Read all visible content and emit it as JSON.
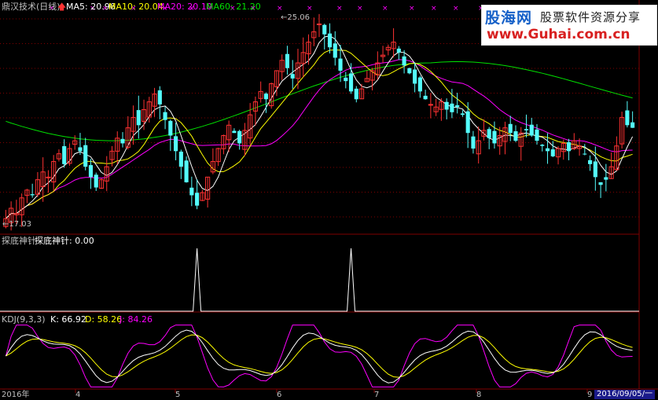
{
  "header": {
    "title": "鼎汉技术(日线)",
    "ma5": "MA5: 20.96",
    "ma10": "MA10: 20.04",
    "ma20": "MA20: 20.10",
    "ma60": "MA60: 21.20",
    "high_mark": "25.06",
    "low_mark": "17.03"
  },
  "indicator1": {
    "name": "探底神针",
    "label": "探底神针",
    "value": "0.00"
  },
  "indicator2": {
    "name": "KDJ(9,3,3)",
    "k": "K: 66.92",
    "d": "D: 58.26",
    "j": "J: 84.26"
  },
  "xaxis": {
    "start": "2016年",
    "months": [
      "4",
      "5",
      "6",
      "7",
      "8",
      "9"
    ],
    "cursor_date": "2016/09/05/一"
  },
  "watermark": {
    "line1a": "股海网",
    "line1b": "股票软件资源分享",
    "line2": "www.Guhai.com.cn"
  },
  "colors": {
    "up": "#ff3232",
    "down": "#54fcfc",
    "ma5": "#ffffff",
    "ma10": "#ffff00",
    "ma20": "#ff00ff",
    "ma60": "#00e000",
    "grid": "#800000"
  },
  "chart_data": [
    {
      "type": "candlestick",
      "title": "鼎汉技术(日线)",
      "series": [
        {
          "name": "MA5",
          "last": 20.96
        },
        {
          "name": "MA10",
          "last": 20.04
        },
        {
          "name": "MA20",
          "last": 20.1
        },
        {
          "name": "MA60",
          "last": 21.2
        }
      ],
      "annotations": {
        "high": 25.06,
        "low": 17.03
      },
      "ylim": [
        16.8,
        25.4
      ],
      "x_tick_labels": [
        "2016年",
        "4",
        "5",
        "6",
        "7",
        "8",
        "9"
      ],
      "close": [
        17.4,
        17.8,
        17.6,
        18.2,
        18.5,
        18.3,
        18.9,
        19.2,
        19.0,
        19.6,
        19.9,
        19.5,
        20.1,
        20.4,
        20.0,
        19.4,
        19.0,
        18.6,
        18.9,
        19.4,
        20.0,
        20.5,
        20.3,
        20.9,
        21.3,
        21.0,
        21.6,
        21.9,
        22.2,
        21.8,
        21.2,
        20.6,
        20.0,
        19.4,
        18.8,
        18.3,
        17.9,
        18.4,
        19.0,
        19.6,
        20.1,
        20.6,
        21.0,
        20.7,
        20.3,
        20.8,
        21.4,
        21.9,
        22.3,
        22.0,
        22.6,
        23.1,
        23.5,
        23.2,
        22.8,
        23.4,
        23.8,
        24.2,
        24.6,
        24.9,
        24.5,
        24.0,
        23.6,
        23.1,
        22.7,
        22.3,
        22.0,
        22.4,
        22.8,
        23.1,
        23.4,
        23.7,
        24.0,
        24.2,
        23.8,
        23.3,
        23.0,
        22.6,
        22.3,
        22.0,
        21.8,
        21.7,
        21.9,
        21.6,
        21.5,
        21.7,
        21.4,
        20.7,
        20.1,
        20.4,
        20.8,
        20.5,
        20.3,
        20.6,
        20.9,
        20.7,
        20.4,
        20.7,
        20.8,
        20.6,
        20.4,
        20.2,
        20.0,
        19.8,
        20.1,
        20.3,
        20.0,
        20.4,
        20.2,
        19.9,
        19.5,
        19.0,
        18.7,
        18.9,
        19.4,
        20.2,
        21.3,
        21.0,
        20.9
      ]
    },
    {
      "type": "line",
      "title": "探底神针",
      "series": [
        {
          "name": "探底神针",
          "last": 0.0
        }
      ],
      "spikes": [
        {
          "bar": 36,
          "value": 1
        },
        {
          "bar": 65,
          "value": 1
        }
      ]
    },
    {
      "type": "line",
      "title": "KDJ(9,3,3)",
      "series": [
        {
          "name": "K",
          "last": 66.92
        },
        {
          "name": "D",
          "last": 58.26
        },
        {
          "name": "J",
          "last": 84.26
        }
      ]
    }
  ]
}
